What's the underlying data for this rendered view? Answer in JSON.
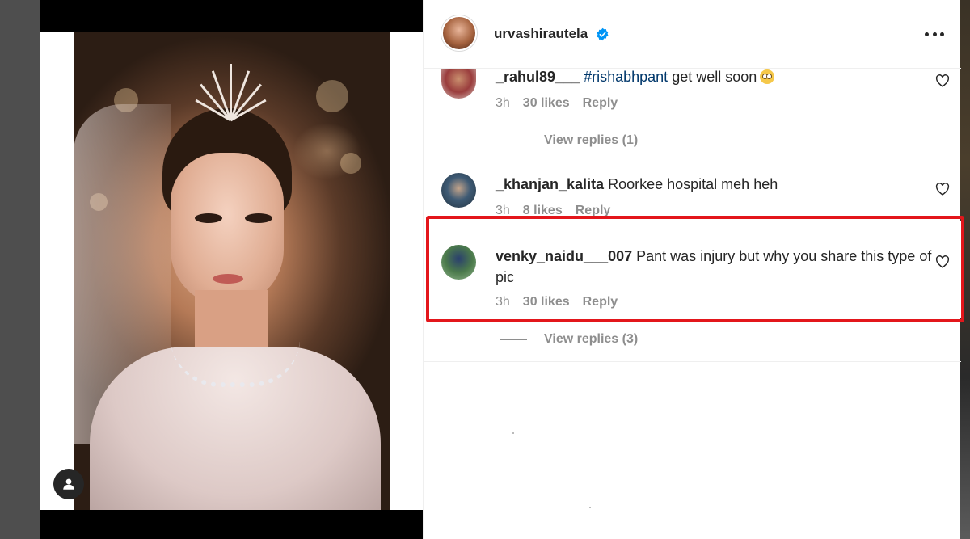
{
  "post": {
    "username": "urvashirautela",
    "verified": true,
    "icons": {
      "verified": "verified-badge-icon",
      "more": "more-options-icon",
      "user_tag": "user-tag-icon"
    }
  },
  "comments": [
    {
      "username": "_rahul89___",
      "hashtag": "#rishabhpant",
      "text": "get well soon",
      "emoji": "flushed-face-emoji",
      "time": "3h",
      "likes": "30 likes",
      "reply": "Reply",
      "view_replies": "View replies (1)"
    },
    {
      "username": "_khanjan_kalita",
      "text": "Roorkee hospital meh heh",
      "time": "3h",
      "likes": "8 likes",
      "reply": "Reply"
    },
    {
      "username": "venky_naidu___007",
      "text": "Pant was injury but why you share this type of pic",
      "time": "3h",
      "likes": "30 likes",
      "reply": "Reply",
      "view_replies": "View replies (3)",
      "highlighted": true
    }
  ],
  "colors": {
    "highlight": "#e3161b",
    "verified": "#0095f6",
    "hashtag": "#00376b",
    "meta": "#8e8e8e"
  }
}
